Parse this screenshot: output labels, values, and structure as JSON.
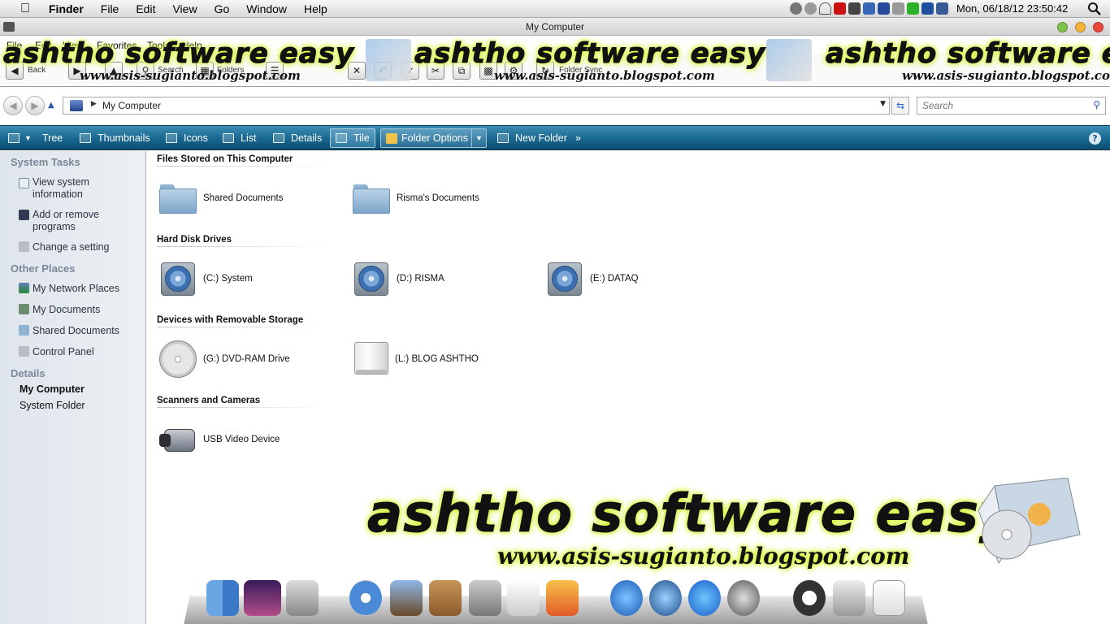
{
  "menubar": {
    "app": "Finder",
    "items": [
      "File",
      "Edit",
      "View",
      "Go",
      "Window",
      "Help"
    ],
    "clock": "Mon, 06/18/12  23:50:42"
  },
  "window": {
    "title": "My Computer"
  },
  "xp_menu": [
    "File",
    "Edit",
    "View",
    "Favorites",
    "Tools",
    "Help"
  ],
  "toolbar": {
    "back": "Back",
    "search": "Search",
    "folders": "Folders",
    "folder_sync": "Folder Sync"
  },
  "banner": {
    "brand": "ashtho software easy",
    "url": "www.asis-sugianto.blogspot.com"
  },
  "address": {
    "location": "My Computer"
  },
  "search": {
    "placeholder": "Search"
  },
  "commands": {
    "tree": "Tree",
    "thumbnails": "Thumbnails",
    "icons": "Icons",
    "list": "List",
    "details": "Details",
    "tile": "Tile",
    "folder_options": "Folder Options",
    "new_folder": "New Folder",
    "more": "»",
    "help": "?"
  },
  "sidebar": {
    "system_tasks": {
      "title": "System Tasks",
      "items": [
        {
          "line1": "View system",
          "line2": "information"
        },
        {
          "line1": "Add or remove",
          "line2": "programs"
        },
        {
          "line1": "Change a setting",
          "line2": ""
        }
      ]
    },
    "other_places": {
      "title": "Other Places",
      "items": [
        "My Network Places",
        "My Documents",
        "Shared Documents",
        "Control Panel"
      ]
    },
    "details": {
      "title": "Details",
      "name": "My Computer",
      "type": "System Folder"
    }
  },
  "groups": {
    "files": {
      "title": "Files Stored on This Computer",
      "items": [
        "Shared Documents",
        "Risma's Documents"
      ]
    },
    "drives": {
      "title": "Hard Disk Drives",
      "items": [
        "(C:) System",
        "(D:) RISMA",
        "(E:) DATAQ"
      ]
    },
    "removable": {
      "title": "Devices with Removable Storage",
      "items": [
        "(G:) DVD-RAM Drive",
        "(L:) BLOG ASHTHO"
      ]
    },
    "scanners": {
      "title": "Scanners and Cameras",
      "items": [
        "USB Video Device"
      ]
    }
  },
  "dock": {
    "icons": [
      "finder-icon",
      "photo-icon",
      "disk-utility-icon",
      "safari-icon",
      "mail-icon",
      "address-book-icon",
      "calculator-icon",
      "textedit-icon",
      "app-store-pencil-icon",
      "itunes-icon",
      "quicktime-icon",
      "app-store-icon",
      "launchpad-icon",
      "power-icon",
      "trash-icon",
      "preview-icon"
    ]
  },
  "colors": {
    "cmdbar": "#1b6a93",
    "banner_glow": "#d4f53a",
    "sidebar_heading": "#7a8799"
  }
}
